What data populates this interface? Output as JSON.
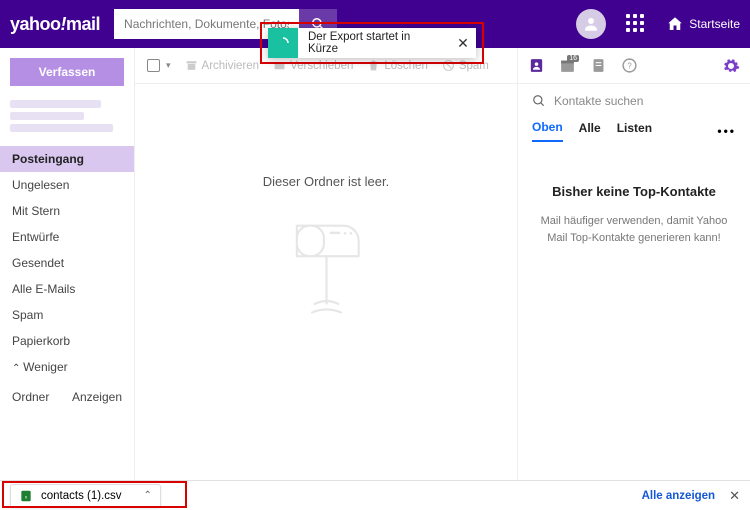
{
  "header": {
    "logo_pre": "yahoo",
    "logo_post": "mail",
    "search_placeholder": "Nachrichten, Dokumente, Fotos oder Personen s",
    "home_label": "Startseite"
  },
  "toast": {
    "message": "Der Export startet in Kürze",
    "close": "✕"
  },
  "sidebar": {
    "compose": "Verfassen",
    "items": [
      {
        "label": "Posteingang",
        "active": true
      },
      {
        "label": "Ungelesen"
      },
      {
        "label": "Mit Stern"
      },
      {
        "label": "Entwürfe"
      },
      {
        "label": "Gesendet"
      },
      {
        "label": "Alle E-Mails"
      },
      {
        "label": "Spam"
      },
      {
        "label": "Papierkorb"
      }
    ],
    "weniger": "Weniger",
    "ordner": "Ordner",
    "anzeigen": "Anzeigen"
  },
  "toolbar": {
    "archive": "Archivieren",
    "move": "Verschieben",
    "delete": "Löschen",
    "spam": "Spam"
  },
  "main": {
    "empty_text": "Dieser Ordner ist leer."
  },
  "panel": {
    "calendar_badge": "16",
    "search_placeholder": "Kontakte suchen",
    "tabs": {
      "oben": "Oben",
      "alle": "Alle",
      "listen": "Listen"
    },
    "more": "•••",
    "empty_title": "Bisher keine Top-Kontakte",
    "empty_sub": "Mail häufiger verwenden, damit Yahoo Mail Top-Kontakte generieren kann!"
  },
  "download": {
    "filename": "contacts (1).csv",
    "chev": "⌃",
    "show_all": "Alle anzeigen",
    "close": "✕"
  }
}
